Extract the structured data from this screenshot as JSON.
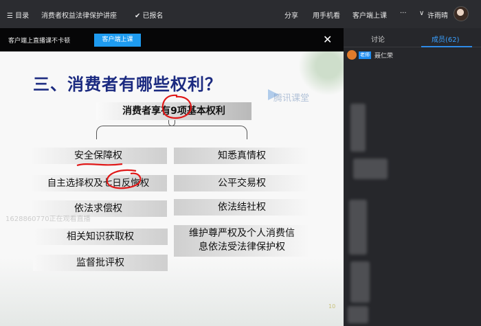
{
  "topbar": {
    "menu_label": "☰ 目录",
    "course_title": "消费者权益法律保护讲座",
    "enrolled": "✔ 已报名",
    "share": "分享",
    "mobile": "用手机看",
    "client_class": "客户端上课",
    "more": "···",
    "user_name": "许雨晴"
  },
  "banner": {
    "text": "客户端上直播课不卡顿",
    "button": "客户端上课",
    "close": "✕"
  },
  "slide": {
    "title": "三、消费者有哪些权利？",
    "subtitle": "消费者享有9项基本权利",
    "brand": "腾讯课堂",
    "watermark": "1628860770正在观看直播",
    "page_number": "10",
    "rights_left": [
      "安全保障权",
      "自主选择权及七日反悔权",
      "依法求偿权",
      "相关知识获取权",
      "监督批评权"
    ],
    "rights_right": [
      "知悉真情权",
      "公平交易权",
      "依法结社权",
      "维护尊严权及个人消费信",
      "息依法受法律保护权"
    ]
  },
  "sidepanel": {
    "tab_discuss": "讨论",
    "tab_members": "成员(62)",
    "teacher_badge": "老师",
    "teacher_name": "聂仁荣"
  }
}
